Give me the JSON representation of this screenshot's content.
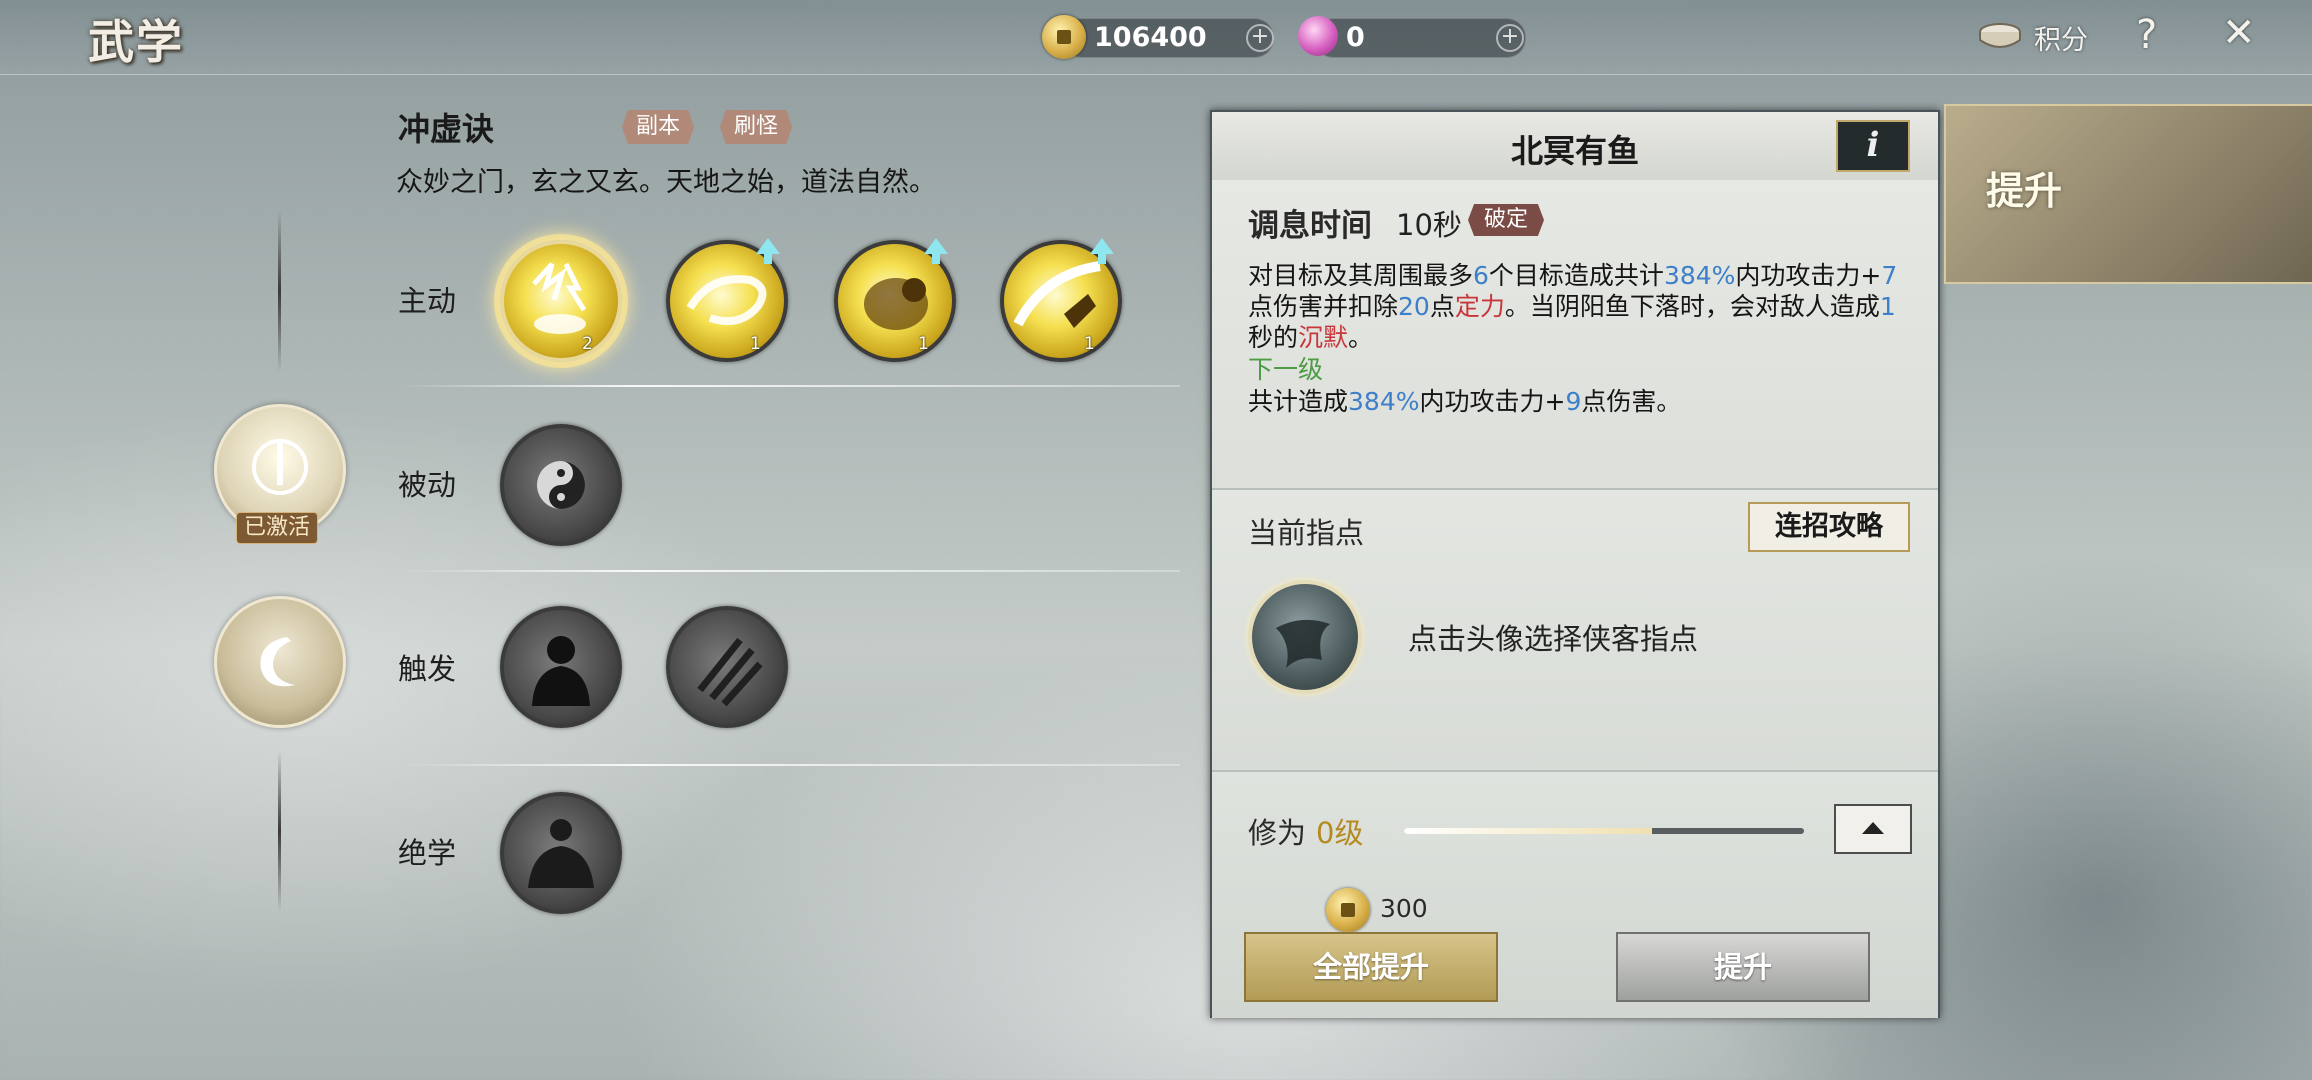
{
  "header": {
    "title": "武学",
    "coins": "106400",
    "gems": "0",
    "points_label": "积分",
    "help_label": "?",
    "close_label": "✕"
  },
  "skill_set": {
    "name": "冲虚诀",
    "tags": [
      "副本",
      "刷怪"
    ],
    "description": "众妙之门，玄之又玄。天地之始，道法自然。"
  },
  "categories": [
    {
      "label": "主动",
      "skills": [
        {
          "icon": "yin-yang-lightning-icon",
          "level": "2",
          "selected": true,
          "upgradable": false
        },
        {
          "icon": "swirl-icon",
          "level": "1",
          "selected": false,
          "upgradable": true
        },
        {
          "icon": "golden-beast-icon",
          "level": "1",
          "selected": false,
          "upgradable": true
        },
        {
          "icon": "sword-slash-icon",
          "level": "1",
          "selected": false,
          "upgradable": true
        }
      ]
    },
    {
      "label": "被动",
      "skills": [
        {
          "icon": "yin-yang-icon",
          "locked": true
        }
      ]
    },
    {
      "label": "触发",
      "skills": [
        {
          "icon": "warrior-silhouette-icon",
          "locked": true
        },
        {
          "icon": "claw-strike-icon",
          "locked": true
        }
      ]
    },
    {
      "label": "绝学",
      "skills": [
        {
          "icon": "meditating-figure-icon",
          "locked": true
        }
      ]
    }
  ],
  "category_buttons": {
    "activated_label": "已激活"
  },
  "detail": {
    "title": "北冥有鱼",
    "info_label": "i",
    "cooldown_label": "调息时间",
    "cooldown_value": "10秒",
    "cooldown_tag": "破定",
    "effect": {
      "p1": "对目标及其周围最多",
      "n1": "6",
      "p2": "个目标造成共计",
      "n2": "384%",
      "p3": "内功攻击力+",
      "n3": "7",
      "p4": "点伤害并扣除",
      "n4": "20",
      "p5": "点",
      "r1": "定力",
      "p6": "。当阴阳鱼下落时，会对敌人造成",
      "n5": "1",
      "p7": "秒的",
      "r2": "沉默",
      "p8": "。"
    },
    "next_level_label": "下一级",
    "next": {
      "p1": "共计造成",
      "n1": "384%",
      "p2": "内功攻击力+",
      "n2": "9",
      "p3": "点伤害。"
    },
    "guide_label": "当前指点",
    "combo_button": "连招攻略",
    "guide_hint": "点击头像选择侠客指点",
    "cultivation_label": "修为",
    "cultivation_level": "0级",
    "cultivation_progress": 0.62,
    "cost": "300",
    "upgrade_all_button": "全部提升",
    "upgrade_button": "提升"
  },
  "side_tab": {
    "label": "提升"
  }
}
